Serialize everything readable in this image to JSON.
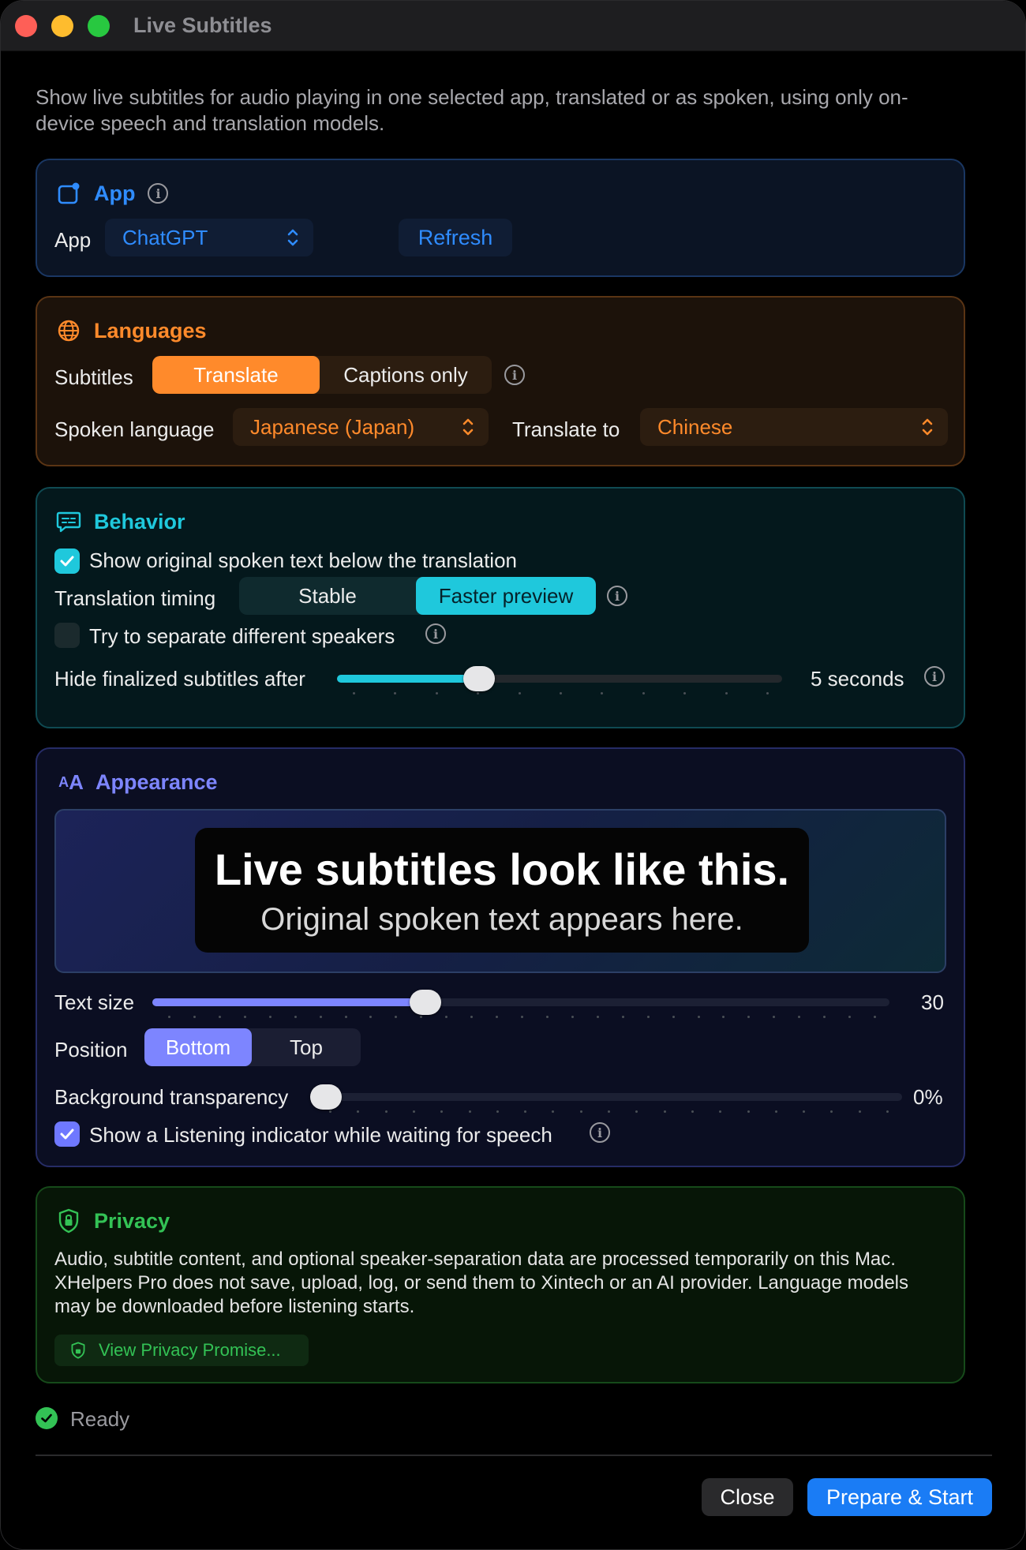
{
  "window": {
    "title": "Live Subtitles"
  },
  "intro": "Show live subtitles for audio playing in one selected app, translated or as spoken, using only on-device speech and translation models.",
  "colors": {
    "app_accent": "#2f8cff",
    "lang_accent": "#ff8a2b",
    "behavior_accent": "#1fc8dc",
    "appearance_accent": "#7d85ff",
    "privacy_accent": "#33c255",
    "primary_button": "#1a7cf5"
  },
  "app_section": {
    "title": "App",
    "icon": "app-window-icon",
    "app_label": "App",
    "app_value": "ChatGPT",
    "refresh_label": "Refresh"
  },
  "languages": {
    "title": "Languages",
    "icon": "globe-icon",
    "subtitles_label": "Subtitles",
    "subtitles_options": [
      "Translate",
      "Captions only"
    ],
    "subtitles_selected": "Translate",
    "spoken_label": "Spoken language",
    "spoken_value": "Japanese (Japan)",
    "translate_to_label": "Translate to",
    "translate_to_value": "Chinese"
  },
  "behavior": {
    "title": "Behavior",
    "icon": "subtitles-bubble-icon",
    "show_original_label": "Show original spoken text below the translation",
    "show_original_checked": true,
    "timing_label": "Translation timing",
    "timing_options": [
      "Stable",
      "Faster preview"
    ],
    "timing_selected": "Faster preview",
    "separate_speakers_label": "Try to separate different speakers",
    "separate_speakers_checked": false,
    "hide_after_label": "Hide finalized subtitles after",
    "hide_after_fraction": 0.32,
    "hide_after_value": "5 seconds"
  },
  "appearance": {
    "title": "Appearance",
    "icon": "text-size-icon",
    "icon_text": "AA",
    "preview_line1": "Live subtitles look like this.",
    "preview_line2": "Original spoken text appears here.",
    "text_size_label": "Text size",
    "text_size_fraction": 0.37,
    "text_size_value": "30",
    "position_label": "Position",
    "position_options": [
      "Bottom",
      "Top"
    ],
    "position_selected": "Bottom",
    "bg_transparency_label": "Background transparency",
    "bg_transparency_fraction": 0.0,
    "bg_transparency_value": "0%",
    "listening_label": "Show a Listening indicator while waiting for speech",
    "listening_checked": true
  },
  "privacy": {
    "title": "Privacy",
    "icon": "shield-lock-icon",
    "body": "Audio, subtitle content, and optional speaker-separation data are processed temporarily on this Mac. XHelpers Pro does not save, upload, log, or send them to Xintech or an AI provider. Language models may be downloaded before listening starts.",
    "link_label": "View Privacy Promise..."
  },
  "status": {
    "text": "Ready",
    "icon": "check-circle-icon"
  },
  "footer": {
    "close_label": "Close",
    "start_label": "Prepare & Start"
  }
}
